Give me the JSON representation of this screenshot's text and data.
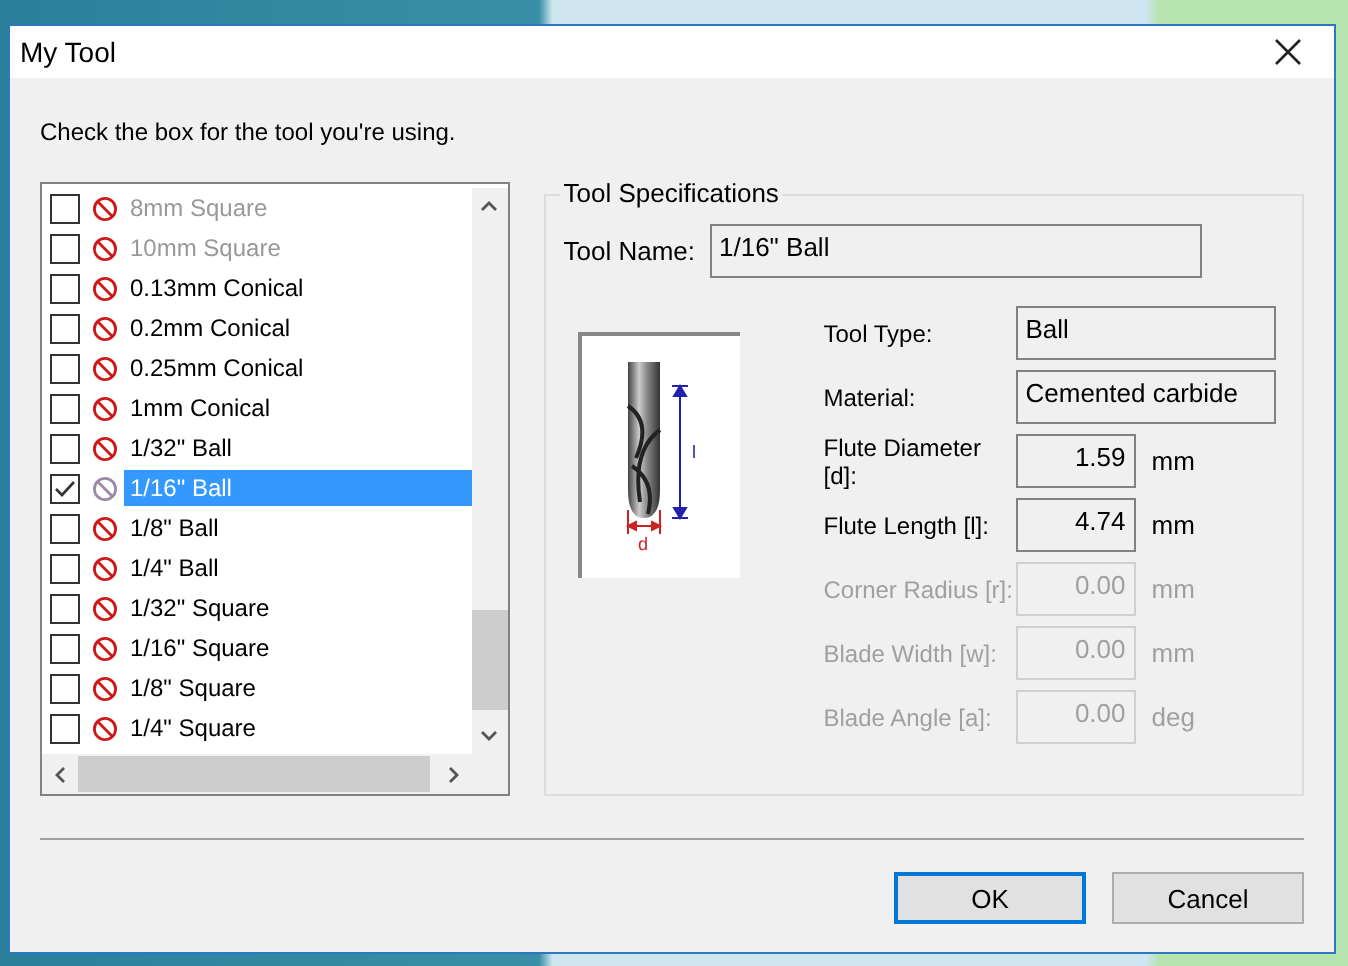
{
  "window": {
    "title": "My Tool"
  },
  "instruction": "Check the box for the tool you're using.",
  "tool_list": {
    "items": [
      {
        "label": "8mm Square",
        "checked": false,
        "selected": false,
        "disabled": true
      },
      {
        "label": "10mm Square",
        "checked": false,
        "selected": false,
        "disabled": true
      },
      {
        "label": "0.13mm Conical",
        "checked": false,
        "selected": false,
        "disabled": false
      },
      {
        "label": "0.2mm Conical",
        "checked": false,
        "selected": false,
        "disabled": false
      },
      {
        "label": "0.25mm Conical",
        "checked": false,
        "selected": false,
        "disabled": false
      },
      {
        "label": "1mm Conical",
        "checked": false,
        "selected": false,
        "disabled": false
      },
      {
        "label": "1/32\" Ball",
        "checked": false,
        "selected": false,
        "disabled": false
      },
      {
        "label": "1/16\" Ball",
        "checked": true,
        "selected": true,
        "disabled": false
      },
      {
        "label": "1/8\" Ball",
        "checked": false,
        "selected": false,
        "disabled": false
      },
      {
        "label": "1/4\" Ball",
        "checked": false,
        "selected": false,
        "disabled": false
      },
      {
        "label": "1/32\" Square",
        "checked": false,
        "selected": false,
        "disabled": false
      },
      {
        "label": "1/16\" Square",
        "checked": false,
        "selected": false,
        "disabled": false
      },
      {
        "label": "1/8\" Square",
        "checked": false,
        "selected": false,
        "disabled": false
      },
      {
        "label": "1/4\" Square",
        "checked": false,
        "selected": false,
        "disabled": false
      }
    ]
  },
  "tool_specifications": {
    "title": "Tool Specifications",
    "tool_name_label": "Tool Name:",
    "tool_name": "1/16\" Ball",
    "fields": [
      {
        "kind": "text",
        "label": "Tool Type:",
        "value": "Ball",
        "disabled": false
      },
      {
        "kind": "text",
        "label": "Material:",
        "value": "Cemented carbide",
        "disabled": false
      },
      {
        "kind": "number",
        "label": "Flute Diameter [d]:",
        "value": "1.59",
        "unit": "mm",
        "disabled": false
      },
      {
        "kind": "number",
        "label": "Flute Length [l]:",
        "value": "4.74",
        "unit": "mm",
        "disabled": false
      },
      {
        "kind": "number",
        "label": "Corner Radius [r]:",
        "value": "0.00",
        "unit": "mm",
        "disabled": true
      },
      {
        "kind": "number",
        "label": "Blade Width [w]:",
        "value": "0.00",
        "unit": "mm",
        "disabled": true
      },
      {
        "kind": "number",
        "label": "Blade Angle [a]:",
        "value": "0.00",
        "unit": "deg",
        "disabled": true
      }
    ],
    "diagram": {
      "length_label": "l",
      "diameter_label": "d"
    }
  },
  "buttons": [
    {
      "label": "OK",
      "default": true
    },
    {
      "label": "Cancel",
      "default": false
    }
  ]
}
